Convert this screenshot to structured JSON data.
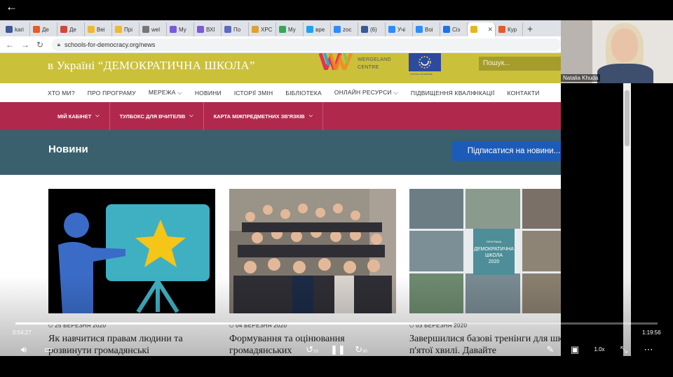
{
  "browser": {
    "tabs": [
      {
        "label": "kari",
        "color": "#3b5998"
      },
      {
        "label": "Де",
        "color": "#e55b2a"
      },
      {
        "label": "Де",
        "color": "#d44638"
      },
      {
        "label": "Веі",
        "color": "#f2b632"
      },
      {
        "label": "Прі",
        "color": "#f2b632"
      },
      {
        "label": "wel",
        "color": "#777777"
      },
      {
        "label": "Му",
        "color": "#7a5bd6"
      },
      {
        "label": "ВХІ",
        "color": "#7a5bd6"
      },
      {
        "label": "По",
        "color": "#5c6bc0"
      },
      {
        "label": "ХРС",
        "color": "#e0a030"
      },
      {
        "label": "Му",
        "color": "#34a853"
      },
      {
        "label": "вре",
        "color": "#1da1f2"
      },
      {
        "label": "zoc",
        "color": "#2d8cff"
      },
      {
        "label": "(6)",
        "color": "#3b5998"
      },
      {
        "label": "Учі",
        "color": "#2d8cff"
      },
      {
        "label": "Воі",
        "color": "#2d8cff"
      },
      {
        "label": "Сіз",
        "color": "#1a73e8"
      },
      {
        "label": "",
        "color": "#e8b422",
        "active": true
      },
      {
        "label": "Кур",
        "color": "#e55b2a"
      }
    ],
    "close_glyph": "✕",
    "new_tab_glyph": "+",
    "url": "schools-for-democracy.org/news"
  },
  "site": {
    "header_title": "в Україні “ДЕМОКРАТИЧНА ШКОЛА”",
    "wergeland": "WERGELAND\nCENTRE",
    "coe": "COUNCIL OF EUROPE",
    "search_placeholder": "Пошук...",
    "main_nav": [
      {
        "label": "ХТО МИ?"
      },
      {
        "label": "ПРО ПРОГРАМУ"
      },
      {
        "label": "МЕРЕЖА ⌵"
      },
      {
        "label": "НОВИНИ",
        "active": true
      },
      {
        "label": "ІСТОРІЇ ЗМІН"
      },
      {
        "label": "БІБЛІОТЕКА"
      },
      {
        "label": "ОНЛАЙН РЕСУРСИ ⌵"
      },
      {
        "label": "ПІДВИЩЕННЯ КВАЛІФІКАЦІЇ"
      },
      {
        "label": "КОНТАКТИ"
      }
    ],
    "sub_nav": [
      {
        "label": "МІЙ КАБІНЕТ"
      },
      {
        "label": "ТУЛБОКС ДЛЯ ВЧИТЕЛІВ"
      },
      {
        "label": "КАРТА МІЖПРЕДМЕТНИХ ЗВ'ЯЗКІВ"
      }
    ],
    "section_title": "Новини",
    "subscribe_label": "Підписатися на новини...",
    "cards": [
      {
        "date": "25 БЕРЕЗНЯ 2020",
        "title": "Як навчитися правам людини та розвинути громадянські"
      },
      {
        "date": "04 БЕРЕЗНЯ 2020",
        "title": "Формування та оцінювання громадянських"
      },
      {
        "date": "03 БЕРЕЗНЯ 2020",
        "title": "Завершилися базові тренінги для шкіл п'ятої хвилі. Давайте"
      }
    ],
    "collage_text": "ДЕМОКРАТИЧНА\nШКОЛА\n2020",
    "collage_caption": "ПРОГРАМА"
  },
  "webcam": {
    "name": "Natalia Khuda"
  },
  "player": {
    "current_time": "0:54:27",
    "total_time": "1:19:56",
    "progress": 0.681,
    "back_glyph": "←",
    "rewind_label": "10",
    "forward_label": "30",
    "speed_label": "1.0x"
  }
}
